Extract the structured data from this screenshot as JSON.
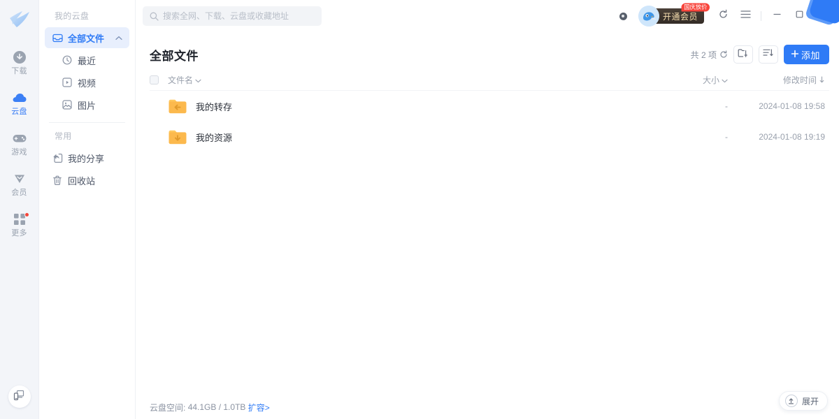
{
  "app": {
    "logo_icon": "bird-logo-icon",
    "accent_color": "#2f7bf6",
    "active_nav_bg": "#e8effd"
  },
  "rail": {
    "items": [
      {
        "label": "下载",
        "icon": "download-circle-icon",
        "active": false,
        "dot": false
      },
      {
        "label": "云盘",
        "icon": "cloud-icon",
        "active": true,
        "dot": false
      },
      {
        "label": "游戏",
        "icon": "gamepad-icon",
        "active": false,
        "dot": false
      },
      {
        "label": "会员",
        "icon": "diamond-icon",
        "active": false,
        "dot": false
      },
      {
        "label": "更多",
        "icon": "grid-more-icon",
        "active": false,
        "dot": true
      }
    ],
    "bottom_button": {
      "icon": "phone-to-pc-icon",
      "name": "remote-transfer-button"
    }
  },
  "sidebar": {
    "section_cloud": "我的云盘",
    "section_common": "常用",
    "items": [
      {
        "label": "全部文件",
        "icon": "inbox-icon",
        "active": true,
        "chevron": "up"
      },
      {
        "label": "最近",
        "icon": "clock-icon",
        "active": false,
        "sub": true
      },
      {
        "label": "视频",
        "icon": "video-icon",
        "active": false,
        "sub": true
      },
      {
        "label": "图片",
        "icon": "image-icon",
        "active": false,
        "sub": true
      }
    ],
    "common_items": [
      {
        "label": "我的分享",
        "icon": "share-icon"
      },
      {
        "label": "回收站",
        "icon": "trash-icon"
      }
    ]
  },
  "topbar": {
    "search": {
      "placeholder": "搜索全网、下载、云盘或收藏地址",
      "value": "",
      "icon": "search-icon"
    },
    "notice_badge_icon": "notice-dot-icon",
    "avatar_icon": "bird-avatar-icon",
    "vip_button_label": "开通会员",
    "vip_tag_label": "国庆放价",
    "window_controls": [
      {
        "name": "history-button",
        "icon": "refresh-history-icon"
      },
      {
        "name": "menu-button",
        "icon": "hamburger-icon"
      },
      {
        "name": "minimize-button",
        "icon": "minimize-icon"
      },
      {
        "name": "maximize-button",
        "icon": "maximize-icon"
      },
      {
        "name": "close-button",
        "icon": "close-icon"
      }
    ]
  },
  "content": {
    "page_title": "全部文件",
    "count_text": "共 2 项",
    "refresh_icon": "refresh-icon",
    "new_folder_icon": "new-folder-icon",
    "sort_icon": "sort-list-icon",
    "add_button_label": "添加",
    "columns": {
      "name": "文件名",
      "size": "大小",
      "time": "修改时间"
    },
    "rows": [
      {
        "name": "我的转存",
        "icon": "folder-save-icon",
        "size": "-",
        "time": "2024-01-08 19:58"
      },
      {
        "name": "我的资源",
        "icon": "folder-download-icon",
        "size": "-",
        "time": "2024-01-08 19:19"
      }
    ]
  },
  "footer": {
    "storage_label": "云盘空间:",
    "storage_value": "44.1GB / 1.0TB",
    "expand_link": "扩容>",
    "expand_pill_label": "展开",
    "expand_pill_icon": "upload-icon"
  }
}
